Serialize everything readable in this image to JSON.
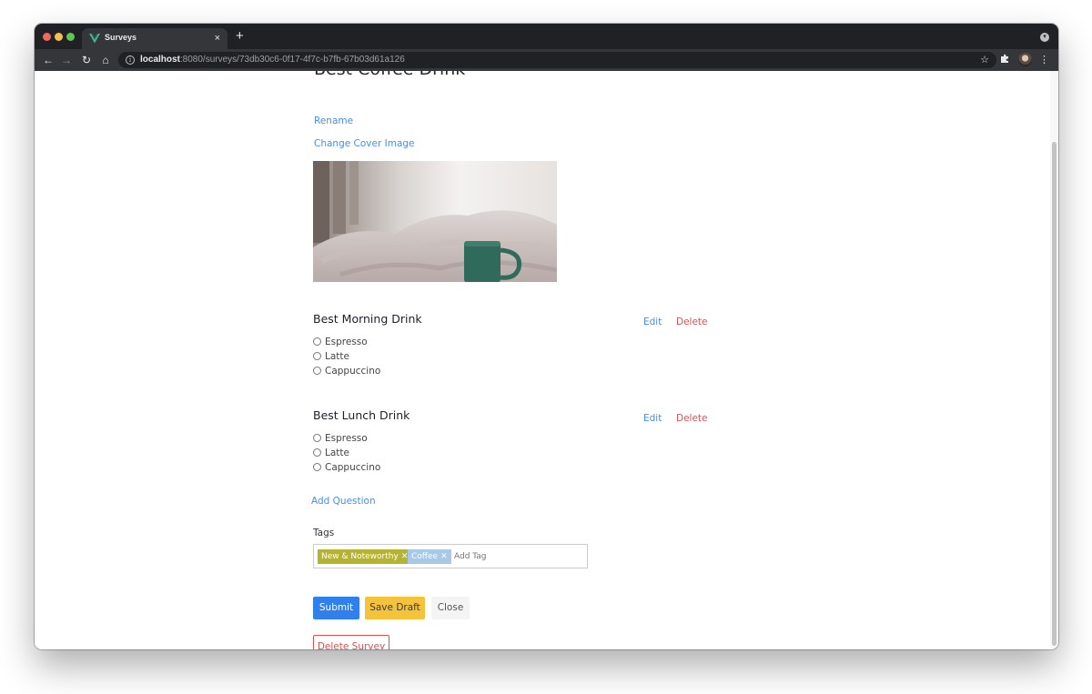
{
  "browser": {
    "tab_title": "Surveys",
    "tab_close": "×",
    "new_tab": "+",
    "url_host": "localhost",
    "url_rest": ":8080/surveys/73db30c6-0f17-4f7c-b7fb-67b03d61a126",
    "icons": [
      "back-icon",
      "forward-icon",
      "reload-icon",
      "home-icon",
      "info-icon",
      "star-icon",
      "puzzle-icon",
      "kebab-icon"
    ]
  },
  "survey": {
    "title": "Best Coffee Drink",
    "rename_label": "Rename",
    "change_cover_label": "Change Cover Image",
    "cover_alt": "",
    "questions": [
      {
        "title": "Best Morning Drink",
        "edit_label": "Edit",
        "delete_label": "Delete",
        "options": [
          "Espresso",
          "Latte",
          "Cappuccino"
        ]
      },
      {
        "title": "Best Lunch Drink",
        "edit_label": "Edit",
        "delete_label": "Delete",
        "options": [
          "Espresso",
          "Latte",
          "Cappuccino"
        ]
      }
    ],
    "add_question_label": "Add Question",
    "tags_label": "Tags",
    "tags": [
      {
        "label": "New & Noteworthy",
        "color": "#b5b334"
      },
      {
        "label": "Coffee",
        "color": "#a9c8e6"
      }
    ],
    "add_tag_placeholder": "Add Tag",
    "actions": {
      "submit_label": "Submit",
      "save_draft_label": "Save Draft",
      "close_label": "Close",
      "delete_survey_label": "Delete Survey"
    }
  },
  "colors": {
    "link": "#4a8de0",
    "danger": "#d9534f",
    "primary": "#2f80ed",
    "warning": "#f5c33b"
  }
}
